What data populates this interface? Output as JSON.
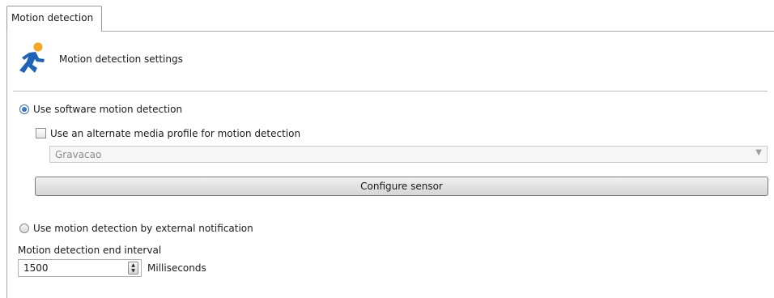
{
  "tabs": [
    {
      "label": "Motion detection",
      "active": true
    }
  ],
  "header": {
    "title": "Motion detection settings",
    "icon": "running-man-icon"
  },
  "software_detection": {
    "radio_label": "Use software motion detection",
    "selected": true,
    "alt_profile": {
      "checkbox_label": "Use an alternate media profile for motion detection",
      "checked": false,
      "profile_select": {
        "value": "Gravacao",
        "enabled": false
      }
    },
    "configure_button": "Configure sensor"
  },
  "external_detection": {
    "radio_label": "Use motion detection by external notification",
    "selected": false
  },
  "end_interval": {
    "label": "Motion detection end interval",
    "value": "1500",
    "unit": "Milliseconds"
  },
  "colors": {
    "accent": "#3b6fb6",
    "icon_blue": "#1e63b8",
    "icon_orange": "#f5a623"
  }
}
